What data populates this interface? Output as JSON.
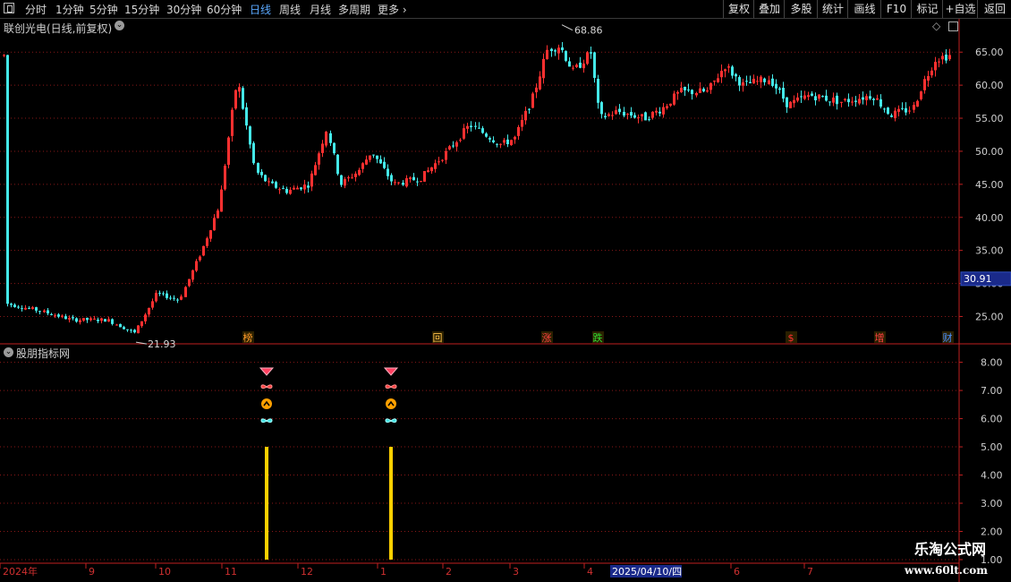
{
  "toolbar": {
    "periods": [
      "分时",
      "1分钟",
      "5分钟",
      "15分钟",
      "30分钟",
      "60分钟",
      "日线",
      "周线",
      "月线",
      "多周期",
      "更多"
    ],
    "active_period": "日线",
    "right_buttons": [
      "复权",
      "叠加",
      "多股",
      "统计",
      "画线",
      "F10",
      "标记",
      "+自选",
      "返回"
    ]
  },
  "main_panel": {
    "title": "联创光电(日线,前复权)",
    "current_price": "30.91",
    "high_marker": "68.86",
    "low_marker": "21.93",
    "price_ticks": [
      "65.00",
      "60.00",
      "55.00",
      "50.00",
      "45.00",
      "40.00",
      "35.00",
      "30.00",
      "25.00"
    ],
    "event_markers": [
      {
        "label": "榜",
        "color": "#ff9a2a"
      },
      {
        "label": "回",
        "color": "#ffc04a"
      },
      {
        "label": "涨",
        "color": "#ff4040"
      },
      {
        "label": "跌",
        "color": "#30e030"
      },
      {
        "label": "$",
        "color": "#ff3030"
      },
      {
        "label": "增",
        "color": "#ff4040"
      },
      {
        "label": "财",
        "color": "#4a90ff"
      }
    ]
  },
  "indicator_panel": {
    "title": "股朋指标网",
    "ticks": [
      "8.00",
      "7.00",
      "6.00",
      "5.00",
      "4.00",
      "3.00",
      "2.00",
      "1.00"
    ],
    "icons": [
      "diamond-icon",
      "butterfly-icon",
      "up-arrow-icon",
      "butterfly-icon"
    ]
  },
  "time_axis": {
    "labels": [
      "2024年",
      "9",
      "10",
      "11",
      "12",
      "1",
      "2",
      "3",
      "4",
      "2025/04/10/四",
      "6",
      "7"
    ]
  },
  "watermark": {
    "line1": "乐淘公式网",
    "line2": "www.60lt.com"
  },
  "colors": {
    "up": "#ff3030",
    "down": "#44e8e8",
    "grid": "#8a1818",
    "axis": "#c02020",
    "active": "#5aa8ff",
    "signal": "#ffd000"
  },
  "chart_data": {
    "type": "candlestick",
    "title": "联创光电(日线,前复权)",
    "y_main_range": [
      21.0,
      69.5
    ],
    "y_indicator_range": [
      1.0,
      8.4
    ],
    "series": [
      {
        "name": "联创光电",
        "key_points": [
          {
            "x": "2024-08",
            "close": 27.0
          },
          {
            "x": "2024-09",
            "close": 22.5
          },
          {
            "x": "2024-10",
            "close": 30.0
          },
          {
            "x": "2024-11",
            "close": 45.0
          },
          {
            "x": "2024-12",
            "close": 47.0
          },
          {
            "x": "2025-01",
            "close": 45.5
          },
          {
            "x": "2025-02",
            "close": 52.0
          },
          {
            "x": "2025-03",
            "close": 66.0
          },
          {
            "x": "2025-04",
            "close": 55.0
          },
          {
            "x": "2025-06",
            "close": 62.0
          },
          {
            "x": "2025-07",
            "close": 57.0
          },
          {
            "x": "2025-08",
            "close": 64.0
          }
        ]
      }
    ],
    "high": 68.86,
    "low": 21.93,
    "last": 30.91,
    "signals": [
      {
        "x": "2024-11",
        "value": 5.0
      },
      {
        "x": "2025-01",
        "value": 5.0
      }
    ]
  }
}
